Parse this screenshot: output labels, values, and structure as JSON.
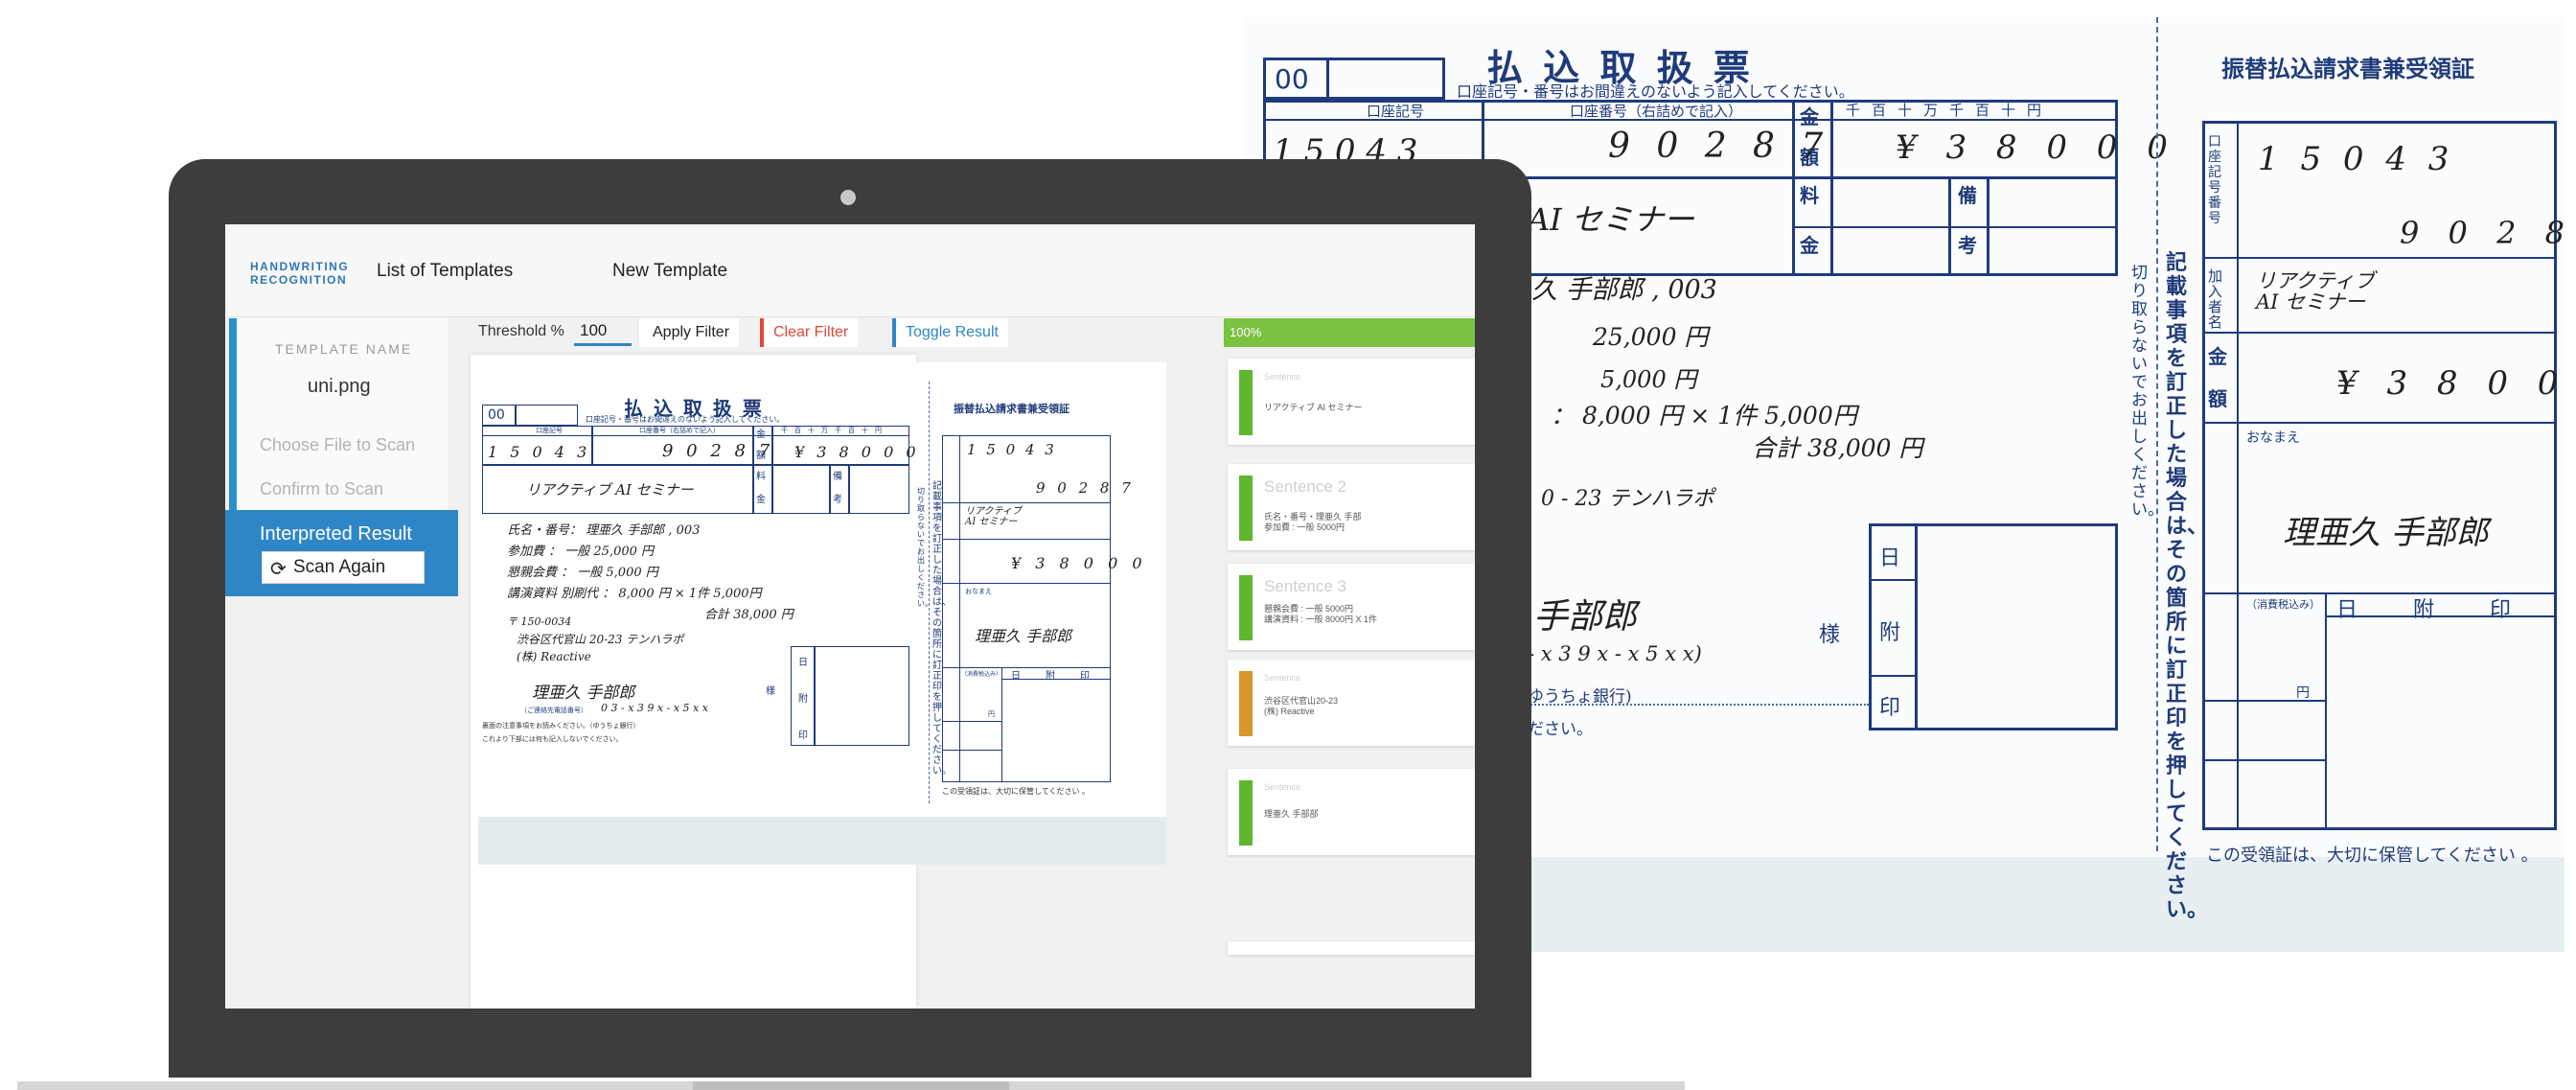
{
  "app": {
    "brand_line1": "HANDWRITING",
    "brand_line2": "RECOGNITION",
    "nav_templates": "List of Templates",
    "nav_new": "New Template"
  },
  "sidebar": {
    "template_title": "TEMPLATE NAME",
    "file_name": "uni.png",
    "choose_file": "Choose File to Scan",
    "confirm": "Confirm to Scan",
    "interpreted": "Interpreted Result",
    "scan_again": "Scan Again",
    "scan_icon": "refresh-icon"
  },
  "toolbar": {
    "threshold_label": "Threshold %",
    "threshold_value": "100",
    "apply_filter": "Apply Filter",
    "clear_filter": "Clear Filter",
    "toggle_result": "Toggle Result"
  },
  "results": {
    "progress_label": "100%",
    "progress_value": 1.0,
    "cards": [
      {
        "heading": "Sentence",
        "line1": "リアクティブ AI セミナー",
        "line2": "",
        "color": "#5fb62f"
      },
      {
        "heading": "Sentence 2",
        "line1": "氏名・番号・理亜久 手部",
        "line2": "参加費 : 一般 5000円",
        "color": "#5fb62f"
      },
      {
        "heading": "Sentence 3",
        "line1": "懇親会費 : 一般 5000円",
        "line2": "講演資料 : 一般 8000円 X 1件",
        "color": "#5fb62f"
      },
      {
        "heading": "Sentence",
        "line1": "渋谷区代官山20-23",
        "line2": "(株) Reactive",
        "color": "#d9962a"
      },
      {
        "heading": "Sentence",
        "line1": "理亜久 手部部",
        "line2": "",
        "color": "#5fb62f"
      }
    ]
  },
  "slip": {
    "code_box": "00",
    "title": "払 込 取 扱 票",
    "notice": "口座記号・番号はお間違えのないよう記入してください。",
    "account_symbol_label": "口座記号",
    "account_number_label": "口座番号（右詰めで記入）",
    "amount_label_1": "金",
    "amount_label_2": "額",
    "fee_label_1": "料",
    "fee_label_2": "金",
    "remarks_label_1": "備",
    "remarks_label_2": "考",
    "units": [
      "千",
      "百",
      "十",
      "万",
      "千",
      "百",
      "十",
      "円"
    ],
    "account_digits": "1 5 0 4 3",
    "account_digit_extra": "1",
    "account_number_digits": "9 0 2 8 7",
    "amount_value": "¥ 3 8 0 0 0",
    "seminar_name": "リアクティブ AI セミナー",
    "line_name": "氏名・番号： 理亜久 手部郎 , 003",
    "line_fee": "参加費 ： 一般 25,000 円",
    "line_party": "懇親会費 ： 一般 5,000 円",
    "line_material": "講演資料 別刷代 ： 8,000 円 × 1件 5,000円",
    "line_total": "合計 38,000 円",
    "postal": "〒 150-0034",
    "address": "渋谷区代官山 20-23 テンハラポ",
    "company": "(株) Reactive",
    "payer": "理亜久 手部郎",
    "sama": "様",
    "phone": "0 3 - x 3 9 x - x 5 x x",
    "phone_note": "（ご連絡先電話番号）",
    "bank_note": "（ゆうちょ銀行）",
    "day_label": "日",
    "attach_label": "附",
    "stamp_label": "印",
    "footer_note": "裏面の注意事項をお読みください。（ゆうちょ銀行）",
    "footer_note2": "これより下部には何も記入しないでください。",
    "cut_note": "切り取らないでお出しください。",
    "correction_note": "記載事項を訂正した場合は、その箇所に訂正印を押してください。",
    "receipt_title": "振替払込請求書兼受領証",
    "receipt_side_1": "口座記号番号",
    "receipt_side_2": "加入者名",
    "receipt_name": "リアクティブ AI セミナー",
    "receipt_amount": "¥ 3 8 0 0 0",
    "receipt_payer_label": "おなまえ",
    "receipt_payer": "理亜久 手部郎",
    "receipt_fee_note": "（消費税込み）",
    "yen": "円",
    "receipt_footer": "この受領証は、大切に保管してください 。",
    "bg_seminar": "AI セミナー",
    "bg_line_name": "久 手部郎 , 003",
    "bg_line_fee": "25,000 円",
    "bg_line_party": "5,000 円",
    "bg_line_material": "： 8,000 円 × 1件 5,000円",
    "bg_line_total": "合計 38,000 円",
    "bg_address": "0 - 23 テンハラポ",
    "bg_payer": "手部郎",
    "bg_phone": "- x 3 9 x - x 5 x x)",
    "bg_bank": "ゆうちょ銀行)",
    "bg_footer": "ださい。"
  },
  "colors": {
    "accent_blue": "#2f86c6",
    "clear_red": "#e0483a",
    "progress_green": "#7cc242",
    "form_blue": "#1f3b7a"
  }
}
